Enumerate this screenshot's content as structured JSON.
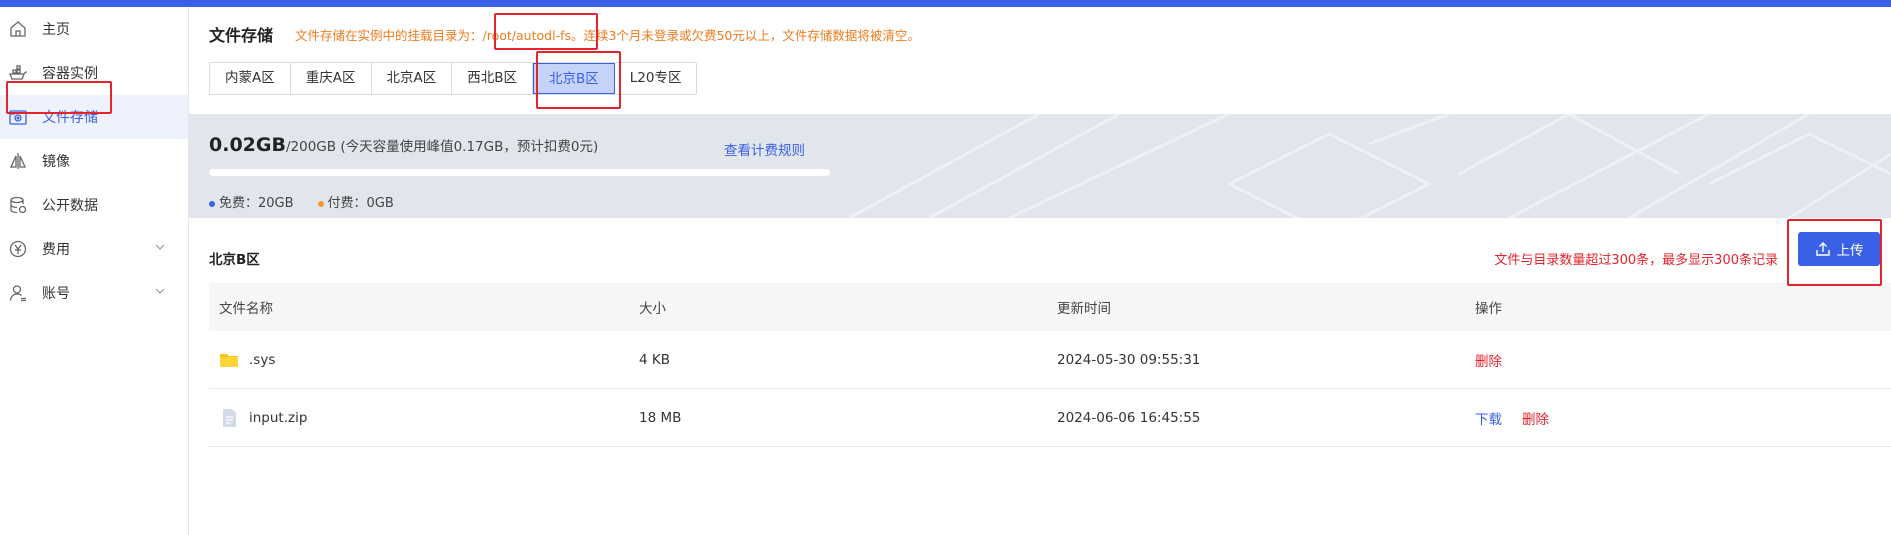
{
  "sidebar": {
    "items": [
      {
        "label": "主页",
        "icon": "home-icon"
      },
      {
        "label": "容器实例",
        "icon": "container-icon"
      },
      {
        "label": "文件存储",
        "icon": "storage-icon"
      },
      {
        "label": "镜像",
        "icon": "mirror-icon"
      },
      {
        "label": "公开数据",
        "icon": "database-icon"
      },
      {
        "label": "费用",
        "icon": "yen-icon"
      },
      {
        "label": "账号",
        "icon": "user-icon"
      }
    ],
    "active_index": 2
  },
  "header": {
    "title": "文件存储",
    "notice_prefix": "文件存储在实例中的挂载目录为：",
    "mount_path": "/root/autodl-fs",
    "notice_suffix": "。连续3个月未登录或欠费50元以上，文件存储数据将被清空。"
  },
  "tabs": [
    "内蒙A区",
    "重庆A区",
    "北京A区",
    "西北B区",
    "北京B区",
    "L20专区"
  ],
  "active_tab": "北京B区",
  "usage": {
    "used": "0.02GB",
    "total": "/200GB",
    "note": "(今天容量使用峰值0.17GB，预计扣费0元)",
    "rule_link": "查看计费规则",
    "fraction_used": 0.0001,
    "free_label": "免费：20GB",
    "paid_label": "付费：0GB"
  },
  "section": {
    "region": "北京B区",
    "limit_note": "文件与目录数量超过300条，最多显示300条记录",
    "upload_label": "上传"
  },
  "table": {
    "columns": [
      "文件名称",
      "大小",
      "更新时间",
      "操作"
    ],
    "rows": [
      {
        "name": ".sys",
        "type": "folder",
        "size": "4 KB",
        "updated": "2024-05-30 09:55:31",
        "download": "",
        "delete": "删除"
      },
      {
        "name": "input.zip",
        "type": "file",
        "size": "18 MB",
        "updated": "2024-06-06 16:45:55",
        "download": "下载",
        "delete": "删除"
      }
    ]
  },
  "colors": {
    "accent": "#3a60e6",
    "warning": "#f07b1c",
    "danger": "#e5232c"
  }
}
